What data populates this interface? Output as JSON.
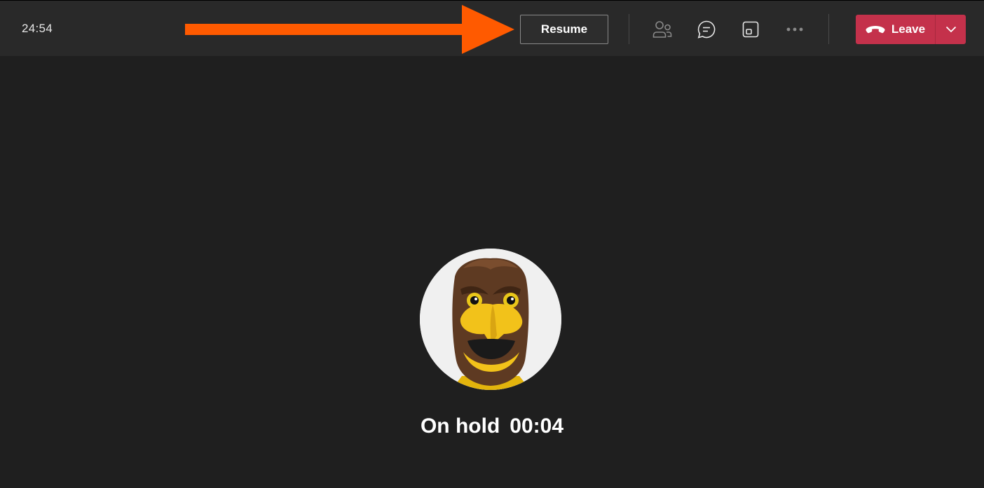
{
  "call": {
    "elapsed_time": "24:54",
    "hold_label": "On hold",
    "hold_duration": "00:04"
  },
  "toolbar": {
    "resume_label": "Resume",
    "leave_label": "Leave",
    "icons": [
      "people-icon",
      "chat-icon",
      "share-screen-icon",
      "more-icon",
      "hang-up-icon",
      "chevron-down-icon"
    ]
  },
  "colors": {
    "background": "#1f1f1f",
    "topbar": "#292929",
    "leave_button": "#c4314b",
    "annotation_arrow": "#ff5a00"
  }
}
